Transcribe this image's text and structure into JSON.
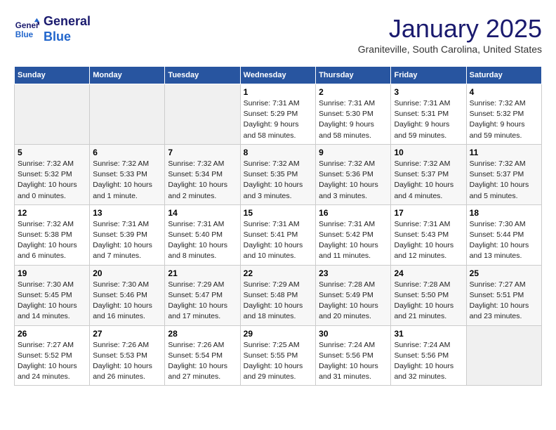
{
  "header": {
    "logo_line1": "General",
    "logo_line2": "Blue",
    "month": "January 2025",
    "location": "Graniteville, South Carolina, United States"
  },
  "weekdays": [
    "Sunday",
    "Monday",
    "Tuesday",
    "Wednesday",
    "Thursday",
    "Friday",
    "Saturday"
  ],
  "weeks": [
    [
      {
        "day": "",
        "info": ""
      },
      {
        "day": "",
        "info": ""
      },
      {
        "day": "",
        "info": ""
      },
      {
        "day": "1",
        "info": "Sunrise: 7:31 AM\nSunset: 5:29 PM\nDaylight: 9 hours\nand 58 minutes."
      },
      {
        "day": "2",
        "info": "Sunrise: 7:31 AM\nSunset: 5:30 PM\nDaylight: 9 hours\nand 58 minutes."
      },
      {
        "day": "3",
        "info": "Sunrise: 7:31 AM\nSunset: 5:31 PM\nDaylight: 9 hours\nand 59 minutes."
      },
      {
        "day": "4",
        "info": "Sunrise: 7:32 AM\nSunset: 5:32 PM\nDaylight: 9 hours\nand 59 minutes."
      }
    ],
    [
      {
        "day": "5",
        "info": "Sunrise: 7:32 AM\nSunset: 5:32 PM\nDaylight: 10 hours\nand 0 minutes."
      },
      {
        "day": "6",
        "info": "Sunrise: 7:32 AM\nSunset: 5:33 PM\nDaylight: 10 hours\nand 1 minute."
      },
      {
        "day": "7",
        "info": "Sunrise: 7:32 AM\nSunset: 5:34 PM\nDaylight: 10 hours\nand 2 minutes."
      },
      {
        "day": "8",
        "info": "Sunrise: 7:32 AM\nSunset: 5:35 PM\nDaylight: 10 hours\nand 3 minutes."
      },
      {
        "day": "9",
        "info": "Sunrise: 7:32 AM\nSunset: 5:36 PM\nDaylight: 10 hours\nand 3 minutes."
      },
      {
        "day": "10",
        "info": "Sunrise: 7:32 AM\nSunset: 5:37 PM\nDaylight: 10 hours\nand 4 minutes."
      },
      {
        "day": "11",
        "info": "Sunrise: 7:32 AM\nSunset: 5:37 PM\nDaylight: 10 hours\nand 5 minutes."
      }
    ],
    [
      {
        "day": "12",
        "info": "Sunrise: 7:32 AM\nSunset: 5:38 PM\nDaylight: 10 hours\nand 6 minutes."
      },
      {
        "day": "13",
        "info": "Sunrise: 7:31 AM\nSunset: 5:39 PM\nDaylight: 10 hours\nand 7 minutes."
      },
      {
        "day": "14",
        "info": "Sunrise: 7:31 AM\nSunset: 5:40 PM\nDaylight: 10 hours\nand 8 minutes."
      },
      {
        "day": "15",
        "info": "Sunrise: 7:31 AM\nSunset: 5:41 PM\nDaylight: 10 hours\nand 10 minutes."
      },
      {
        "day": "16",
        "info": "Sunrise: 7:31 AM\nSunset: 5:42 PM\nDaylight: 10 hours\nand 11 minutes."
      },
      {
        "day": "17",
        "info": "Sunrise: 7:31 AM\nSunset: 5:43 PM\nDaylight: 10 hours\nand 12 minutes."
      },
      {
        "day": "18",
        "info": "Sunrise: 7:30 AM\nSunset: 5:44 PM\nDaylight: 10 hours\nand 13 minutes."
      }
    ],
    [
      {
        "day": "19",
        "info": "Sunrise: 7:30 AM\nSunset: 5:45 PM\nDaylight: 10 hours\nand 14 minutes."
      },
      {
        "day": "20",
        "info": "Sunrise: 7:30 AM\nSunset: 5:46 PM\nDaylight: 10 hours\nand 16 minutes."
      },
      {
        "day": "21",
        "info": "Sunrise: 7:29 AM\nSunset: 5:47 PM\nDaylight: 10 hours\nand 17 minutes."
      },
      {
        "day": "22",
        "info": "Sunrise: 7:29 AM\nSunset: 5:48 PM\nDaylight: 10 hours\nand 18 minutes."
      },
      {
        "day": "23",
        "info": "Sunrise: 7:28 AM\nSunset: 5:49 PM\nDaylight: 10 hours\nand 20 minutes."
      },
      {
        "day": "24",
        "info": "Sunrise: 7:28 AM\nSunset: 5:50 PM\nDaylight: 10 hours\nand 21 minutes."
      },
      {
        "day": "25",
        "info": "Sunrise: 7:27 AM\nSunset: 5:51 PM\nDaylight: 10 hours\nand 23 minutes."
      }
    ],
    [
      {
        "day": "26",
        "info": "Sunrise: 7:27 AM\nSunset: 5:52 PM\nDaylight: 10 hours\nand 24 minutes."
      },
      {
        "day": "27",
        "info": "Sunrise: 7:26 AM\nSunset: 5:53 PM\nDaylight: 10 hours\nand 26 minutes."
      },
      {
        "day": "28",
        "info": "Sunrise: 7:26 AM\nSunset: 5:54 PM\nDaylight: 10 hours\nand 27 minutes."
      },
      {
        "day": "29",
        "info": "Sunrise: 7:25 AM\nSunset: 5:55 PM\nDaylight: 10 hours\nand 29 minutes."
      },
      {
        "day": "30",
        "info": "Sunrise: 7:24 AM\nSunset: 5:56 PM\nDaylight: 10 hours\nand 31 minutes."
      },
      {
        "day": "31",
        "info": "Sunrise: 7:24 AM\nSunset: 5:56 PM\nDaylight: 10 hours\nand 32 minutes."
      },
      {
        "day": "",
        "info": ""
      }
    ]
  ]
}
